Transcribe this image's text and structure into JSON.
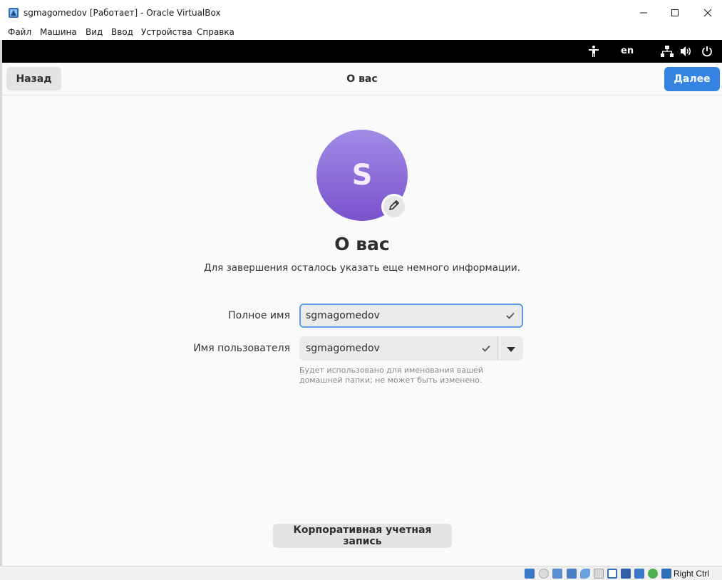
{
  "window": {
    "title": "sgmagomedov [Работает] - Oracle VirtualBox",
    "icons": [
      "virtualbox-icon",
      "minimize-icon",
      "maximize-icon",
      "close-icon"
    ]
  },
  "menubar": {
    "items": [
      "Файл",
      "Машина",
      "Вид",
      "Ввод",
      "Устройства",
      "Справка"
    ]
  },
  "guest_topbar": {
    "language": "en",
    "icons": [
      "accessibility-icon",
      "network-icon",
      "volume-icon",
      "power-icon"
    ]
  },
  "header": {
    "back_label": "Назад",
    "title": "О вас",
    "next_label": "Далее",
    "accent_color": "#3584e4"
  },
  "avatar": {
    "initial": "S",
    "icon": "pencil-icon"
  },
  "content": {
    "heading": "О вас",
    "subtitle": "Для завершения осталось указать еще немного информации."
  },
  "form": {
    "full_name": {
      "label": "Полное имя",
      "value": "sgmagomedov"
    },
    "username": {
      "label": "Имя пользователя",
      "value": "sgmagomedov",
      "hint": "Будет использовано для именования вашей домашней папки; не может быть изменено."
    }
  },
  "enterprise_button": {
    "label": "Корпоративная учетная запись"
  },
  "statusbar": {
    "host_key": "Right Ctrl"
  }
}
